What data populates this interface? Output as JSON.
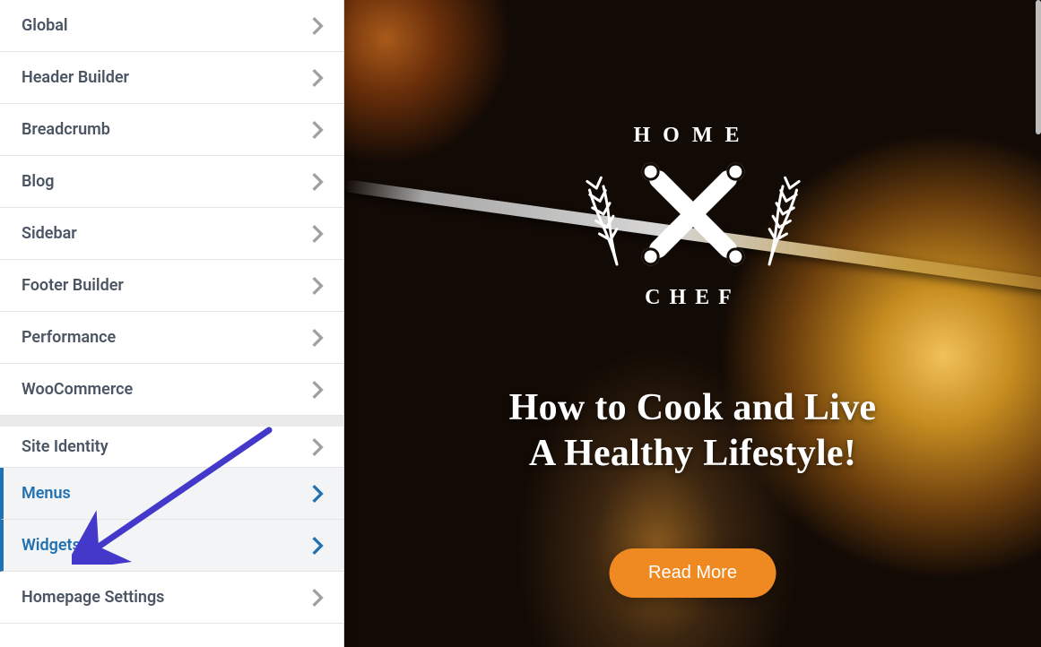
{
  "sidebar": {
    "groups": [
      {
        "items": [
          {
            "id": "global",
            "label": "Global",
            "active": false
          },
          {
            "id": "header-builder",
            "label": "Header Builder",
            "active": false
          },
          {
            "id": "breadcrumb",
            "label": "Breadcrumb",
            "active": false
          },
          {
            "id": "blog",
            "label": "Blog",
            "active": false
          },
          {
            "id": "sidebar",
            "label": "Sidebar",
            "active": false
          },
          {
            "id": "footer-builder",
            "label": "Footer Builder",
            "active": false
          },
          {
            "id": "performance",
            "label": "Performance",
            "active": false
          },
          {
            "id": "woocommerce",
            "label": "WooCommerce",
            "active": false
          }
        ]
      },
      {
        "items": [
          {
            "id": "site-identity",
            "label": "Site Identity",
            "active": false
          },
          {
            "id": "menus",
            "label": "Menus",
            "active": true
          },
          {
            "id": "widgets",
            "label": "Widgets",
            "active": true
          },
          {
            "id": "homepage",
            "label": "Homepage Settings",
            "active": false
          }
        ]
      }
    ]
  },
  "annotation": {
    "target": "widgets"
  },
  "preview": {
    "logo": {
      "top": "HOME",
      "bottom": "CHEF"
    },
    "hero_line1": "How to Cook and Live",
    "hero_line2": "A Healthy Lifestyle!",
    "cta_label": "Read More"
  }
}
